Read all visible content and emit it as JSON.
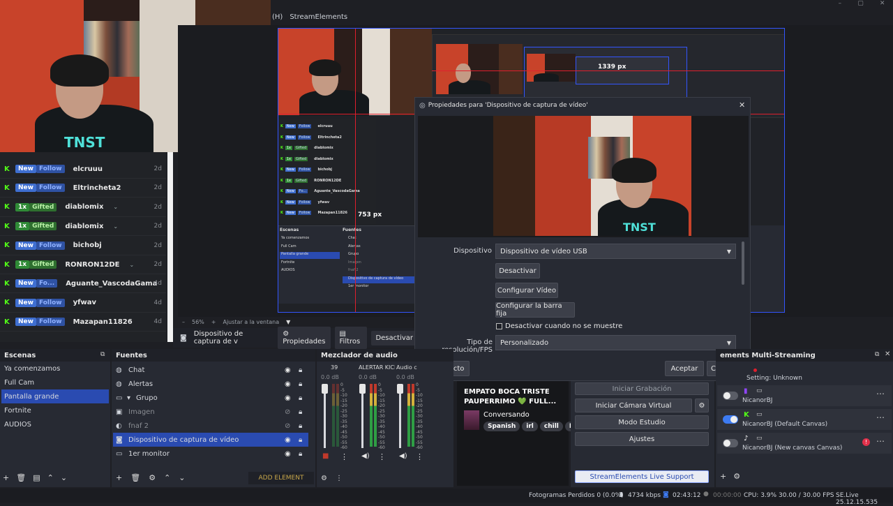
{
  "window": {
    "app_label": "(H)",
    "title": "StreamElements",
    "controls": [
      "–",
      "▢",
      "✕"
    ]
  },
  "alerts": [
    {
      "platform": "K",
      "badge1": "New",
      "badge2": "Follow",
      "name": "elcruuu",
      "age": "2d",
      "chevron": false
    },
    {
      "platform": "K",
      "badge1": "New",
      "badge2": "Follow",
      "name": "Eltrincheta2",
      "age": "2d",
      "chevron": false
    },
    {
      "platform": "K",
      "badge1": "1x",
      "badge2": "Gifted",
      "name": "diablomix",
      "age": "2d",
      "chevron": true
    },
    {
      "platform": "K",
      "badge1": "1x",
      "badge2": "Gifted",
      "name": "diablomix",
      "age": "2d",
      "chevron": true
    },
    {
      "platform": "K",
      "badge1": "New",
      "badge2": "Follow",
      "name": "bichobj",
      "age": "2d",
      "chevron": false
    },
    {
      "platform": "K",
      "badge1": "1x",
      "badge2": "Gifted",
      "name": "RONRON12DE",
      "age": "2d",
      "chevron": true
    },
    {
      "platform": "K",
      "badge1": "New",
      "badge2": "Fo...",
      "name": "Aguante_VascodaGama",
      "age": "4d",
      "chevron": false
    },
    {
      "platform": "K",
      "badge1": "New",
      "badge2": "Follow",
      "name": "yfwav",
      "age": "4d",
      "chevron": false
    },
    {
      "platform": "K",
      "badge1": "New",
      "badge2": "Follow",
      "name": "Mazapan11826",
      "age": "4d",
      "chevron": false
    }
  ],
  "preview": {
    "measure_top": "1339 px",
    "measure_left": "753 px",
    "zoom": "56%",
    "zoom_plus": "+",
    "zoom_minus": "–",
    "fit_label": "Ajustar a la ventana"
  },
  "source_toolbar": {
    "selected_source": "Dispositivo de captura de v",
    "properties": "Propiedades",
    "filters": "Filtros",
    "deactivate": "Desactivar"
  },
  "dialog": {
    "title": "Propiedades para 'Dispositivo de captura de vídeo'",
    "device_label": "Dispositivo",
    "device_value": "Dispositivo de vídeo USB",
    "deactivate_button": "Desactivar",
    "configure_video_button": "Configurar Vídeo",
    "configure_bar_button": "Configurar la barra fija",
    "hide_checkbox_label": "Desactivar cuando no se muestre",
    "resolution_label": "Tipo de resolución/FPS",
    "resolution_value": "Personalizado",
    "defaults_button": "Por defecto",
    "accept_button": "Aceptar",
    "cancel_button": "Cancelar"
  },
  "scenes": {
    "title": "Escenas",
    "items": [
      "Ya comenzamos",
      "Full Cam",
      "Pantalla grande",
      "Fortnite",
      "AUDIOS"
    ],
    "selected_index": 2
  },
  "sources": {
    "title": "Fuentes",
    "items": [
      {
        "label": "Chat",
        "icon": "globe-icon",
        "glyph": "◍",
        "visible": true
      },
      {
        "label": "Alertas",
        "icon": "globe-icon",
        "glyph": "◍",
        "visible": true
      },
      {
        "label": "Grupo",
        "icon": "folder-icon",
        "glyph": "▾ ▭",
        "visible": true
      },
      {
        "label": "Imagen",
        "icon": "image-icon",
        "glyph": "▣",
        "visible": false
      },
      {
        "label": "fnaf 2",
        "icon": "media-icon",
        "glyph": "◐",
        "visible": false
      },
      {
        "label": "Dispositivo de captura de vídeo",
        "icon": "camera-icon",
        "glyph": "◙",
        "visible": true
      },
      {
        "label": "1er monitor",
        "icon": "monitor-icon",
        "glyph": "▭",
        "visible": true
      }
    ],
    "selected_index": 5,
    "add_element": "ADD ELEMENT"
  },
  "mixer": {
    "title": "Mezclador de audio",
    "channels": [
      {
        "name": "39",
        "db": "0.0 dB"
      },
      {
        "name": "ALERTAR KICK",
        "db": "0.0 dB"
      },
      {
        "name": "Audio c",
        "db": "0.0 dB"
      }
    ],
    "scale": [
      "0",
      "-5",
      "-10",
      "-15",
      "-20",
      "-25",
      "-30",
      "-35",
      "-40",
      "-45",
      "-50",
      "-55",
      "-60"
    ]
  },
  "chat_overlay": {
    "title_line1": "EMPATO BOCA TRISTE",
    "title_line2": "PAUPERRIMO 💚 FULL...",
    "status": "Conversando",
    "tags": [
      "Spanish",
      "irl",
      "chill",
      "E"
    ]
  },
  "controls": {
    "start_recording": "Iniciar Grabación",
    "start_virtual_cam": "Iniciar Cámara Virtual",
    "studio_mode": "Modo Estudio",
    "settings": "Ajustes",
    "support": "StreamElements Live Support"
  },
  "multistream": {
    "title": "ements Multi-Streaming",
    "setting_status": "Setting: Unknown",
    "targets": [
      {
        "name": "NicanorBJ",
        "platform": "twitch",
        "on": false
      },
      {
        "name": "NicanorBJ (Default Canvas)",
        "platform": "kick",
        "on": true
      },
      {
        "name": "NicanorBJ (New canvas Canvas)",
        "platform": "tiktok",
        "on": false
      }
    ]
  },
  "status": {
    "dropped_frames": "Fotogramas Perdidos 0 (0.0%)",
    "bitrate": "4734 kbps",
    "stream_time": "02:43:12",
    "rec_time": "00:00:00",
    "cpu": "CPU: 3.9%",
    "fps": "30.00 / 30.00 FPS",
    "version": "SE.Live 25.12.15.535"
  },
  "colors": {
    "accent": "#2a4bb1",
    "kick": "#53fc18",
    "preview_border": "#3355ff",
    "guide": "#e01f2d"
  }
}
